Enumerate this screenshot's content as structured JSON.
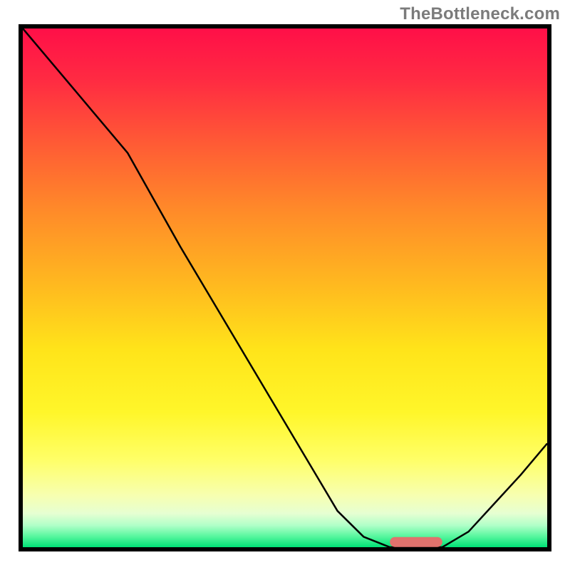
{
  "attribution": "TheBottleneck.com",
  "chart_data": {
    "type": "line",
    "title": "",
    "xlabel": "",
    "ylabel": "",
    "xlim": [
      0,
      100
    ],
    "ylim": [
      0,
      100
    ],
    "x": [
      0,
      5,
      10,
      15,
      20,
      25,
      30,
      35,
      40,
      45,
      50,
      55,
      60,
      65,
      70,
      75,
      80,
      85,
      90,
      95,
      100
    ],
    "values": [
      100,
      94,
      88,
      82,
      76,
      67,
      58,
      49.5,
      41,
      32.5,
      24,
      15.5,
      7,
      2,
      0,
      0,
      0,
      3,
      8.5,
      14,
      20
    ],
    "gradient_stops": [
      {
        "offset": 0.0,
        "color": "#ff0f48"
      },
      {
        "offset": 0.1,
        "color": "#ff2b42"
      },
      {
        "offset": 0.22,
        "color": "#ff5a35"
      },
      {
        "offset": 0.35,
        "color": "#ff8a29"
      },
      {
        "offset": 0.5,
        "color": "#ffbb1f"
      },
      {
        "offset": 0.62,
        "color": "#ffe41a"
      },
      {
        "offset": 0.74,
        "color": "#fff62a"
      },
      {
        "offset": 0.83,
        "color": "#ffff66"
      },
      {
        "offset": 0.9,
        "color": "#f7ffb0"
      },
      {
        "offset": 0.935,
        "color": "#e6ffd2"
      },
      {
        "offset": 0.958,
        "color": "#b0ffc8"
      },
      {
        "offset": 0.978,
        "color": "#5cf7a0"
      },
      {
        "offset": 1.0,
        "color": "#00e276"
      }
    ],
    "marker": {
      "x_start": 70,
      "x_end": 80,
      "y": 1,
      "color": "#e0726d",
      "thickness_px": 14
    }
  }
}
